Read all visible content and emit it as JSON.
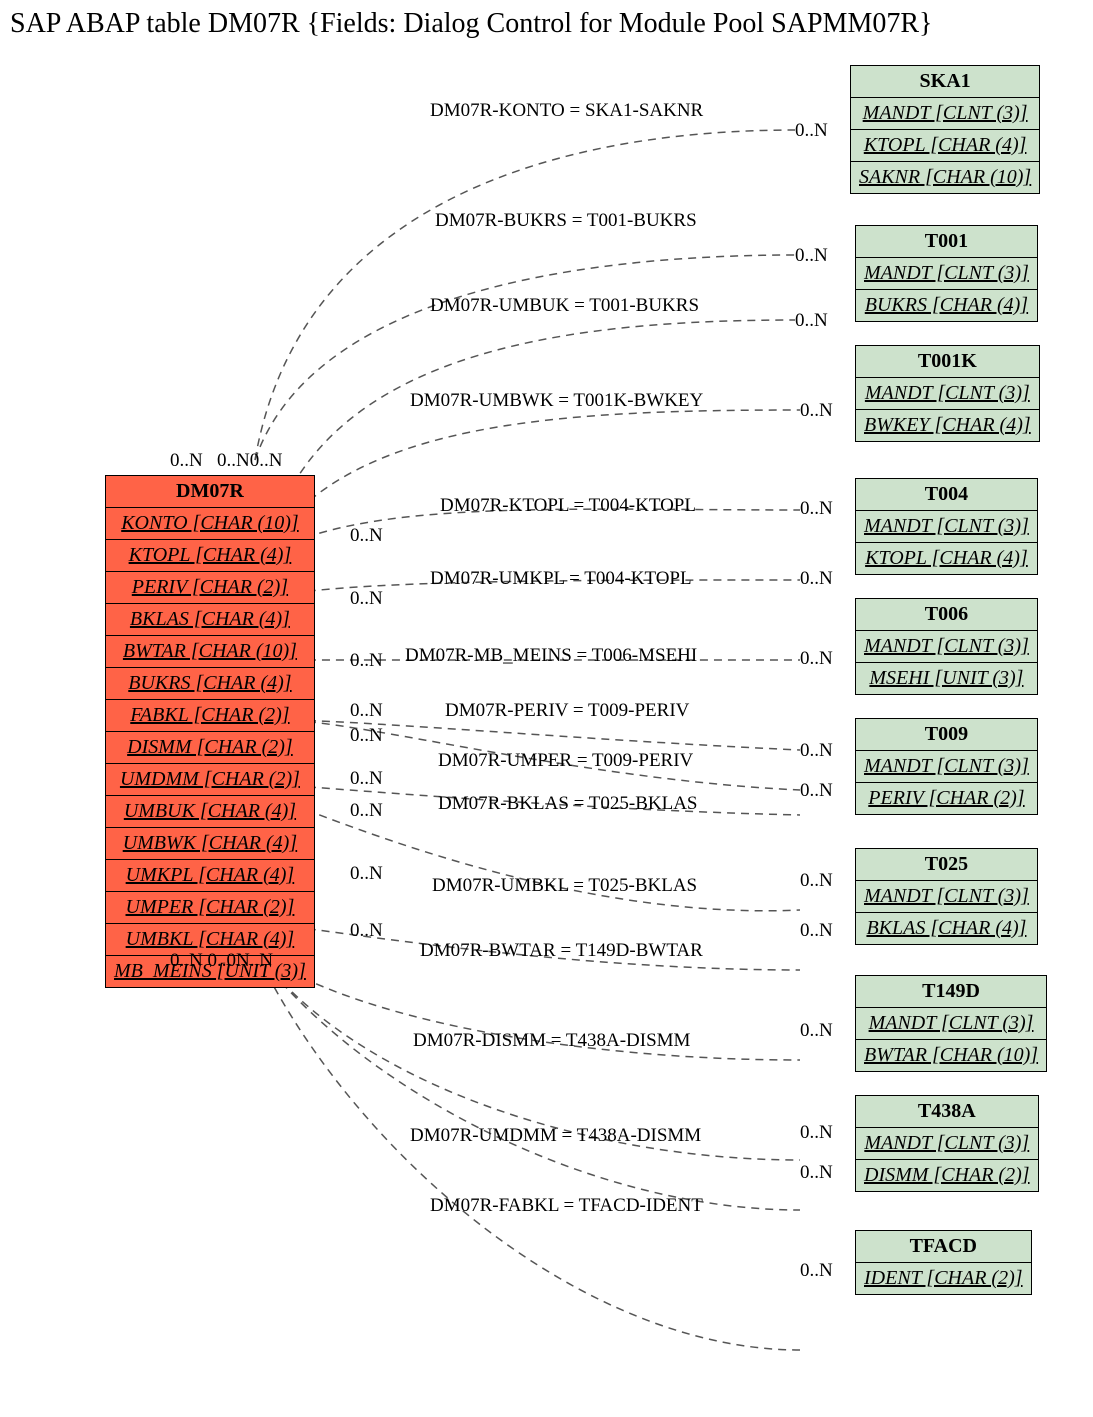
{
  "title": "SAP ABAP table DM07R {Fields: Dialog Control for Module Pool SAPMM07R}",
  "main": {
    "name": "DM07R",
    "fields": [
      "KONTO [CHAR (10)]",
      "KTOPL [CHAR (4)]",
      "PERIV [CHAR (2)]",
      "BKLAS [CHAR (4)]",
      "BWTAR [CHAR (10)]",
      "BUKRS [CHAR (4)]",
      "FABKL [CHAR (2)]",
      "DISMM [CHAR (2)]",
      "UMDMM [CHAR (2)]",
      "UMBUK [CHAR (4)]",
      "UMBWK [CHAR (4)]",
      "UMKPL [CHAR (4)]",
      "UMPER [CHAR (2)]",
      "UMBKL [CHAR (4)]",
      "MB_MEINS [UNIT (3)]"
    ]
  },
  "related": [
    {
      "name": "SKA1",
      "fields": [
        "MANDT [CLNT (3)]",
        "KTOPL [CHAR (4)]",
        "SAKNR [CHAR (10)]"
      ]
    },
    {
      "name": "T001",
      "fields": [
        "MANDT [CLNT (3)]",
        "BUKRS [CHAR (4)]"
      ]
    },
    {
      "name": "T001K",
      "fields": [
        "MANDT [CLNT (3)]",
        "BWKEY [CHAR (4)]"
      ]
    },
    {
      "name": "T004",
      "fields": [
        "MANDT [CLNT (3)]",
        "KTOPL [CHAR (4)]"
      ]
    },
    {
      "name": "T006",
      "fields": [
        "MANDT [CLNT (3)]",
        "MSEHI [UNIT (3)]"
      ]
    },
    {
      "name": "T009",
      "fields": [
        "MANDT [CLNT (3)]",
        "PERIV [CHAR (2)]"
      ]
    },
    {
      "name": "T025",
      "fields": [
        "MANDT [CLNT (3)]",
        "BKLAS [CHAR (4)]"
      ]
    },
    {
      "name": "T149D",
      "fields": [
        "MANDT [CLNT (3)]",
        "BWTAR [CHAR (10)]"
      ]
    },
    {
      "name": "T438A",
      "fields": [
        "MANDT [CLNT (3)]",
        "DISMM [CHAR (2)]"
      ]
    },
    {
      "name": "TFACD",
      "fields": [
        "IDENT [CHAR (2)]"
      ]
    }
  ],
  "joins": [
    "DM07R-KONTO = SKA1-SAKNR",
    "DM07R-BUKRS = T001-BUKRS",
    "DM07R-UMBUK = T001-BUKRS",
    "DM07R-UMBWK = T001K-BWKEY",
    "DM07R-KTOPL = T004-KTOPL",
    "DM07R-UMKPL = T004-KTOPL",
    "DM07R-MB_MEINS = T006-MSEHI",
    "DM07R-PERIV = T009-PERIV",
    "DM07R-UMPER = T009-PERIV",
    "DM07R-BKLAS = T025-BKLAS",
    "DM07R-UMBKL = T025-BKLAS",
    "DM07R-BWTAR = T149D-BWTAR",
    "DM07R-DISMM = T438A-DISMM",
    "DM07R-UMDMM = T438A-DISMM",
    "DM07R-FABKL = TFACD-IDENT"
  ],
  "card": {
    "zeron": "0..N",
    "g1": "0..N   0..N0..N",
    "g2": "0..N 0..0N..N"
  }
}
